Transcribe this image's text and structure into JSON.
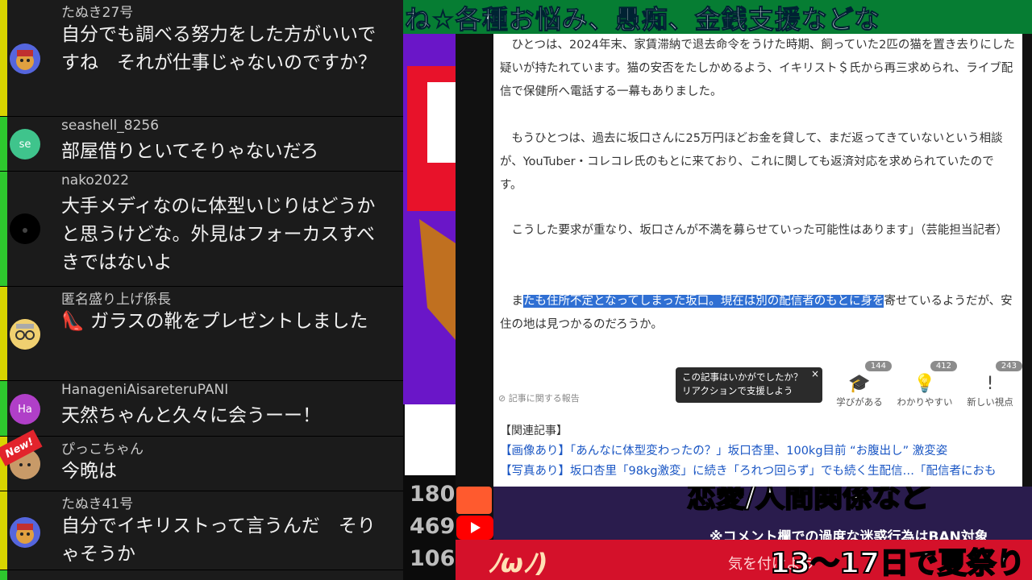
{
  "top_banner": {
    "text": "ね☆各種お悩み、愚痴、金銭支援などな"
  },
  "comments": [
    {
      "username": "たぬき27号",
      "text": "自分でも調べる努力をした方がいいですね　それが仕事じゃないのですか？",
      "bar_color": "#d8d400",
      "avatar": ""
    },
    {
      "username": "seashell_8256",
      "text": "部屋借りといてそりゃないだろ",
      "bar_color": "#2ec82e",
      "avatar": "se"
    },
    {
      "username": "nako2022",
      "text": "大手メディなのに体型いじりはどうかと思うけどな。外見はフォーカスすべきではないよ",
      "bar_color": "#2ec82e",
      "avatar": ""
    },
    {
      "username": "匿名盛り上げ係長",
      "text": "👠 ガラスの靴をプレゼントしました",
      "bar_color": "#d8d400",
      "avatar": ""
    },
    {
      "username": "HanageniAisareteruPANI",
      "text": "天然ちゃんと久々に会うーー！",
      "bar_color": "#2ec82e",
      "avatar": "Ha"
    },
    {
      "username": "ぴっこちゃん",
      "text": "今晩は",
      "bar_color": "#d8d400",
      "avatar": "",
      "badge": "New!"
    },
    {
      "username": "たぬき41号",
      "text": "自分でイキリストって言うんだ　そりゃそうか",
      "bar_color": "#d8d400",
      "avatar": ""
    }
  ],
  "counters": [
    "180",
    "469",
    "106"
  ],
  "article": {
    "p1": "ひとつは、2024年末、家賃滞納で退去命令をうけた時期、飼っていた2匹の猫を置き去りにした疑いが持たれています。猫の安否をたしかめるよう、イキリスト＄氏から再三求められ、ライブ配信で保健所へ電話する一幕もありました。",
    "p2": "もうひとつは、過去に坂口さんに25万円ほどお金を貸して、まだ返ってきていないという相談が、YouTuber・コレコレ氏のもとに来ており、これに関しても返済対応を求められていたのです。",
    "p3": "こうした要求が重なり、坂口さんが不満を募らせていった可能性はあります」（芸能担当記者）",
    "p4_pre": "ま",
    "p4_hl": "たも住所不定となってしまった坂口。現在は別の配信者のもとに身を",
    "p4_post": "寄せているようだが、安住の地は見つかるのだろうか。",
    "popup": "この記事はいかがでしたか？\nリアクションで支援しよう",
    "reactions": [
      {
        "label": "学びがある",
        "count": "144",
        "icon": "graduation-cap-icon"
      },
      {
        "label": "わかりやすい",
        "count": "412",
        "icon": "lightbulb-icon"
      },
      {
        "label": "新しい視点",
        "count": "243",
        "icon": "exclamation-icon"
      }
    ],
    "report": "記事に関する報告",
    "related_heading": "【関連記事】",
    "related": [
      "【画像あり】「あんなに体型変わったの？」坂口杏里、100kg目前 “お腹出し” 激変姿",
      "【写真あり】坂口杏里「98kg激変」に続き「ろれつ回らず」でも続く生配信…「配信者におも"
    ]
  },
  "overlay": {
    "love": "恋愛/人間関係など",
    "warn": "※コメント欄での過度な迷惑行為はBAN対象",
    "kao": "ﾉωﾉ)",
    "careful": "気を付けよう",
    "summer": "13〜17日で夏祭り"
  }
}
